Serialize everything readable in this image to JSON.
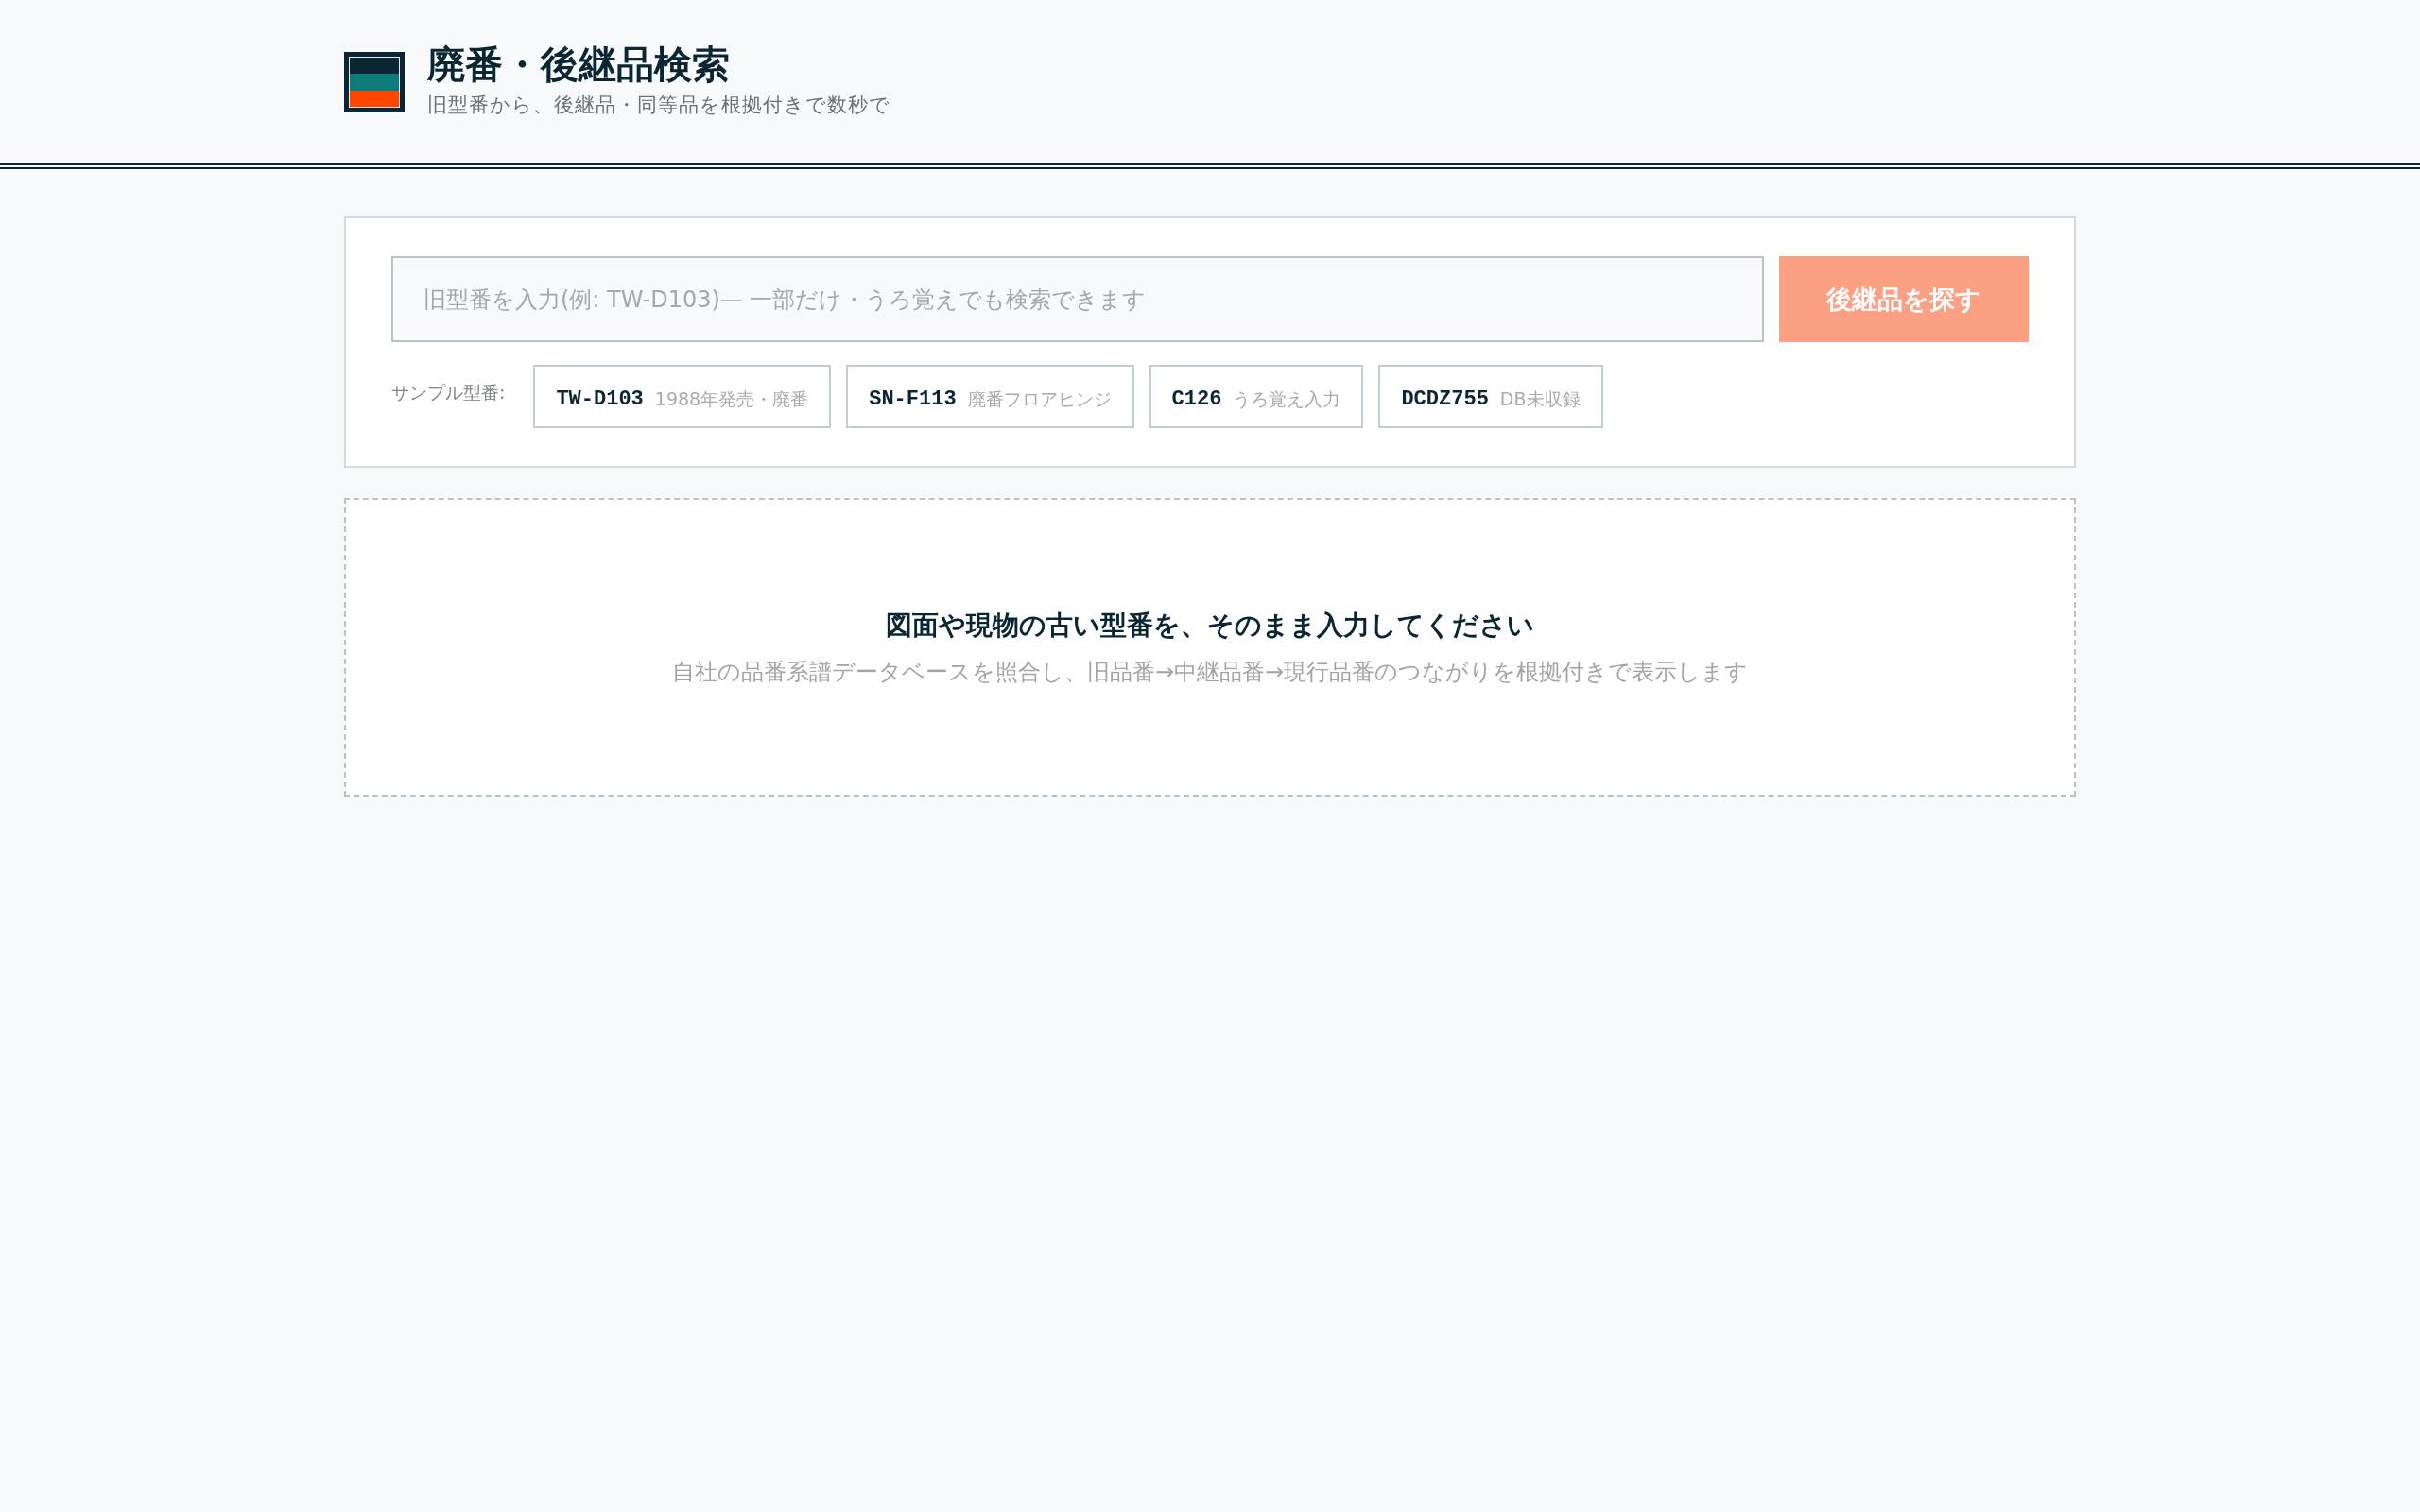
{
  "header": {
    "title": "廃番・後継品検索",
    "subtitle": "旧型番から、後継品・同等品を根拠付きで数秒で"
  },
  "search": {
    "placeholder": "旧型番を入力(例: TW-D103)— 一部だけ・うろ覚えでも検索できます",
    "button": {
      "label": "後継品を探す",
      "disabled": true
    }
  },
  "samples": {
    "label": "サンプル型番:",
    "items": [
      {
        "code": "TW-D103",
        "note": "1988年発売・廃番"
      },
      {
        "code": "SN-F113",
        "note": "廃番フロアヒンジ"
      },
      {
        "code": "C126",
        "note": "うろ覚え入力"
      },
      {
        "code": "DCDZ755",
        "note": "DB未収録"
      }
    ]
  },
  "empty_state": {
    "title": "図面や現物の古い型番を、そのまま入力してください",
    "text": "自社の品番系譜データベースを照合し、旧品番→中継品番→現行品番のつながりを根拠付きで表示します"
  }
}
